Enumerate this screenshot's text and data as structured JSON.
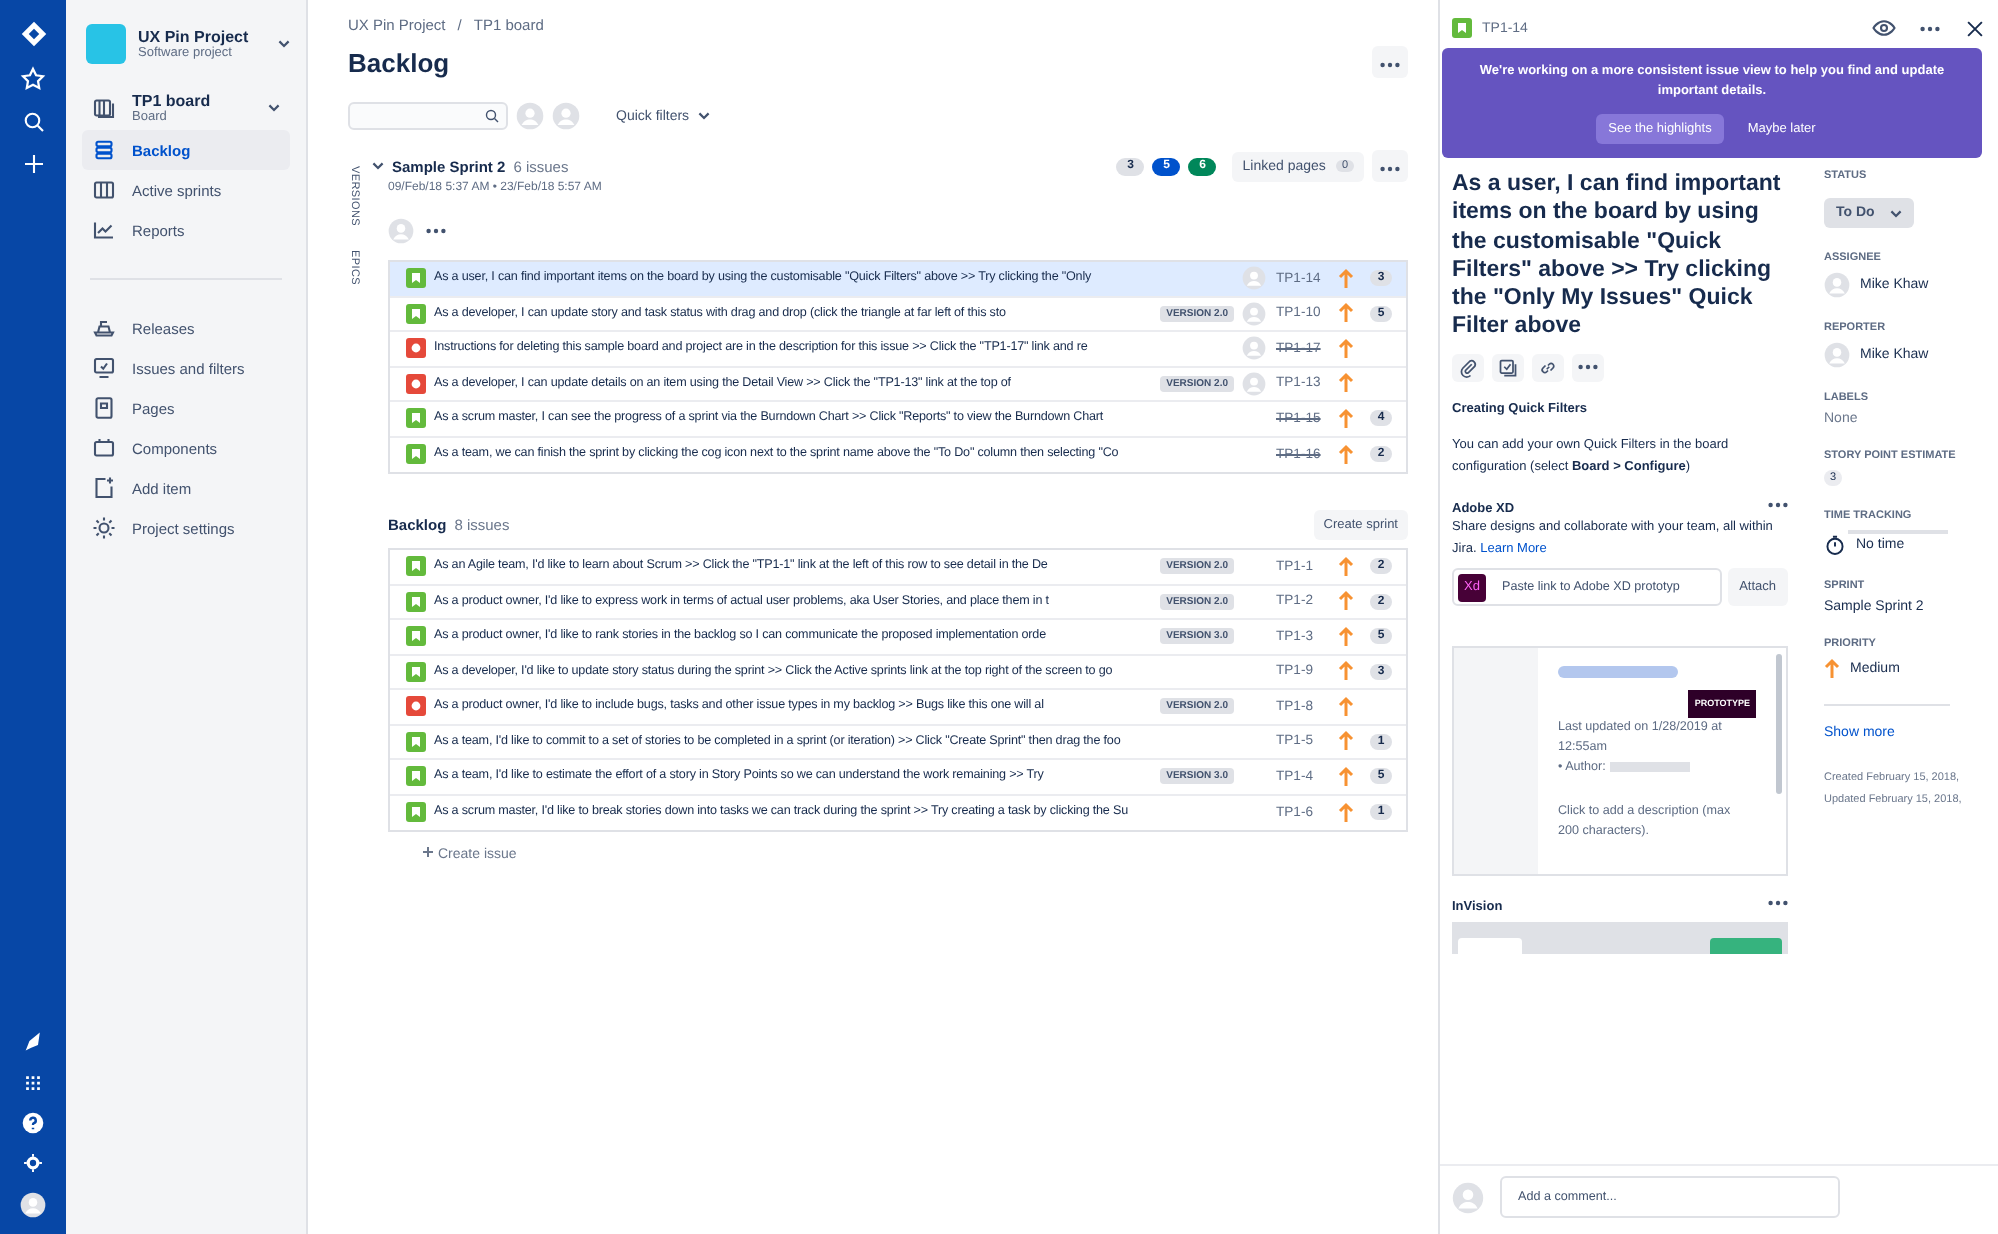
{
  "sidebar": {
    "project": {
      "name": "UX Pin Project",
      "type": "Software project"
    },
    "board": {
      "name": "TP1 board",
      "type": "Board"
    },
    "nav_items": [
      {
        "label": "Backlog",
        "selected": true
      },
      {
        "label": "Active sprints",
        "selected": false
      },
      {
        "label": "Reports",
        "selected": false
      }
    ],
    "more_items": [
      {
        "label": "Releases"
      },
      {
        "label": "Issues and filters"
      },
      {
        "label": "Pages"
      },
      {
        "label": "Components"
      },
      {
        "label": "Add item"
      },
      {
        "label": "Project settings"
      }
    ]
  },
  "main": {
    "breadcrumbs": [
      "UX Pin Project",
      "TP1 board"
    ],
    "breadcrumb_separator": "/",
    "title": "Backlog",
    "quick_filters": "Quick filters",
    "side_tabs": [
      "VERSIONS",
      "EPICS"
    ],
    "sprint": {
      "name": "Sample Sprint 2",
      "count": "6 issues",
      "dates": "09/Feb/18 5:37 AM • 23/Feb/18 5:57 AM",
      "status_counts": [
        {
          "value": "3",
          "color": "#dfe1e6"
        },
        {
          "value": "5",
          "color": "#0052cc"
        },
        {
          "value": "6",
          "color": "#00875a"
        }
      ],
      "linked_pages": {
        "label": "Linked pages",
        "count": "0"
      },
      "issues": [
        {
          "kind": "story",
          "summary": "As a user, I can find important items on the board by using the customisable \"Quick Filters\" above >> Try clicking the \"Only",
          "assigned": true,
          "key": "TP1-14",
          "done": false,
          "points": "3",
          "selected": true
        },
        {
          "kind": "story",
          "summary": "As a developer, I can update story and task status with drag and drop (click the triangle at far left of this sto",
          "version": "VERSION 2.0",
          "assigned": true,
          "key": "TP1-10",
          "done": false,
          "points": "5",
          "selected": false
        },
        {
          "kind": "bug",
          "summary": "Instructions for deleting this sample board and project are in the description for this issue >> Click the \"TP1-17\" link and re",
          "assigned": true,
          "key": "TP1-17",
          "done": true,
          "selected": false
        },
        {
          "kind": "bug",
          "summary": "As a developer, I can update details on an item using the Detail View >> Click the \"TP1-13\" link at the top of",
          "version": "VERSION 2.0",
          "assigned": true,
          "key": "TP1-13",
          "done": false,
          "selected": false
        },
        {
          "kind": "story",
          "summary": "As a scrum master, I can see the progress of a sprint via the Burndown Chart >> Click \"Reports\" to view the Burndown Chart",
          "assigned": false,
          "key": "TP1-15",
          "done": true,
          "points": "4",
          "selected": false
        },
        {
          "kind": "story",
          "summary": "As a team, we can finish the sprint by clicking the cog icon next to the sprint name above the \"To Do\" column then selecting \"Co",
          "assigned": false,
          "key": "TP1-16",
          "done": true,
          "points": "2",
          "selected": false
        }
      ]
    },
    "backlog": {
      "name": "Backlog",
      "count": "8 issues",
      "create_button": "Create sprint",
      "create_issue": "Create issue",
      "issues": [
        {
          "kind": "story",
          "summary": "As an Agile team, I'd like to learn about Scrum >> Click the \"TP1-1\" link at the left of this row to see detail in the De",
          "version": "VERSION 2.0",
          "assigned": false,
          "key": "TP1-1",
          "done": false,
          "points": "2",
          "selected": false
        },
        {
          "kind": "story",
          "summary": "As a product owner, I'd like to express work in terms of actual user problems, aka User Stories, and place them in t",
          "version": "VERSION 2.0",
          "assigned": false,
          "key": "TP1-2",
          "done": false,
          "points": "2",
          "selected": false
        },
        {
          "kind": "story",
          "summary": "As a product owner, I'd like to rank stories in the backlog so I can communicate the proposed implementation orde",
          "version": "VERSION 3.0",
          "assigned": false,
          "key": "TP1-3",
          "done": false,
          "points": "5",
          "selected": false
        },
        {
          "kind": "story",
          "summary": "As a developer, I'd like to update story status during the sprint >> Click the Active sprints link at the top right of the screen to go",
          "assigned": false,
          "key": "TP1-9",
          "done": false,
          "points": "3",
          "selected": false
        },
        {
          "kind": "bug",
          "summary": "As a product owner, I'd like to include bugs, tasks and other issue types in my backlog >> Bugs like this one will al",
          "version": "VERSION 2.0",
          "assigned": false,
          "key": "TP1-8",
          "done": false,
          "selected": false
        },
        {
          "kind": "story",
          "summary": "As a team, I'd like to commit to a set of stories to be completed in a sprint (or iteration) >> Click \"Create Sprint\" then drag the foo",
          "assigned": false,
          "key": "TP1-5",
          "done": false,
          "points": "1",
          "selected": false
        },
        {
          "kind": "story",
          "summary": "As a team, I'd like to estimate the effort of a story in Story Points so we can understand the work remaining >> Try",
          "version": "VERSION 3.0",
          "assigned": false,
          "key": "TP1-4",
          "done": false,
          "points": "5",
          "selected": false
        },
        {
          "kind": "story",
          "summary": "As a scrum master, I'd like to break stories down into tasks we can track during the sprint >> Try creating a task by clicking the Su",
          "assigned": false,
          "key": "TP1-6",
          "done": false,
          "points": "1",
          "selected": false
        }
      ]
    }
  },
  "detail": {
    "issue_key": "TP1-14",
    "banner": {
      "text": "We're working on a more consistent issue view to help you find and update important details.",
      "primary": "See the highlights",
      "secondary": "Maybe later"
    },
    "title": "As a user, I can find important items on the board by using the customisable \"Quick Filters\" above >> Try clicking the \"Only My Issues\" Quick Filter above",
    "description": {
      "heading": "Creating Quick Filters",
      "text": "You can add your own Quick Filters in the board configuration (select **Board > Configure**)"
    },
    "adobe_xd": {
      "title": "Adobe XD",
      "text": "Share designs and collaborate with your team, all within Jira.",
      "link": "Learn More",
      "logo": "Xd",
      "placeholder": "Paste link to Adobe XD prototyp",
      "button": "Attach",
      "card": {
        "badge": "PROTOTYPE",
        "updated": "Last updated on 1/28/2019 at 12:55am",
        "author": "• Author:",
        "description": "Click to add a description (max 200 characters)."
      }
    },
    "invision": {
      "title": "InVision"
    },
    "comment": {
      "placeholder": "Add a comment..."
    },
    "fields": [
      {
        "kind": "dropdown",
        "label": "STATUS",
        "value": "To Do"
      },
      {
        "kind": "person",
        "label": "ASSIGNEE",
        "value": "Mike Khaw"
      },
      {
        "kind": "person",
        "label": "REPORTER",
        "value": "Mike Khaw"
      },
      {
        "kind": "muted",
        "label": "LABELS",
        "value": "None"
      },
      {
        "kind": "badge",
        "label": "STORY POINT ESTIMATE",
        "value": "3"
      },
      {
        "kind": "time",
        "label": "TIME TRACKING",
        "value": "No time"
      },
      {
        "kind": "text",
        "label": "SPRINT",
        "value": "Sample Sprint 2"
      },
      {
        "kind": "priority",
        "label": "PRIORITY",
        "value": "Medium"
      }
    ],
    "show_more": "Show more",
    "created": "Created February 15, 2018,",
    "updated": "Updated February 15, 2018,"
  }
}
